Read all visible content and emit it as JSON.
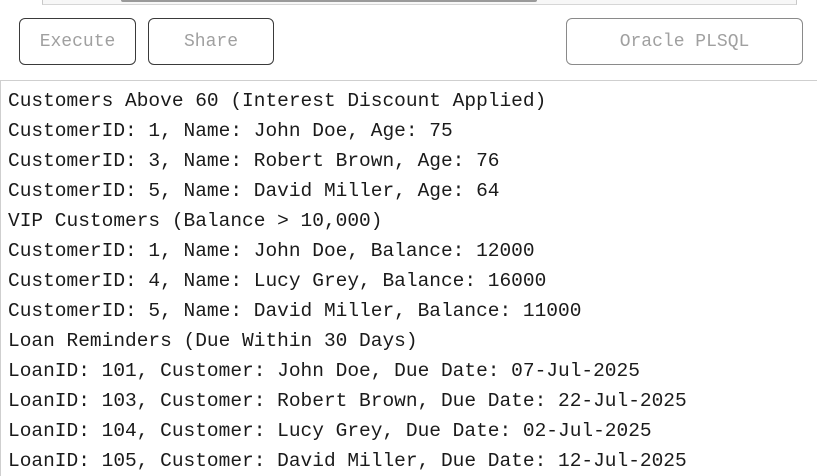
{
  "toolbar": {
    "execute_label": "Execute",
    "share_label": "Share",
    "language_label": "Oracle PLSQL"
  },
  "output": {
    "lines": [
      "Customers Above 60 (Interest Discount Applied)",
      "CustomerID: 1, Name: John Doe, Age: 75",
      "CustomerID: 3, Name: Robert Brown, Age: 76",
      "CustomerID: 5, Name: David Miller, Age: 64",
      "VIP Customers (Balance > 10,000)",
      "CustomerID: 1, Name: John Doe, Balance: 12000",
      "CustomerID: 4, Name: Lucy Grey, Balance: 16000",
      "CustomerID: 5, Name: David Miller, Balance: 11000",
      "Loan Reminders (Due Within 30 Days)",
      "LoanID: 101, Customer: John Doe, Due Date: 07-Jul-2025",
      "LoanID: 103, Customer: Robert Brown, Due Date: 22-Jul-2025",
      "LoanID: 104, Customer: Lucy Grey, Due Date: 02-Jul-2025",
      "LoanID: 105, Customer: David Miller, Due Date: 12-Jul-2025"
    ]
  }
}
